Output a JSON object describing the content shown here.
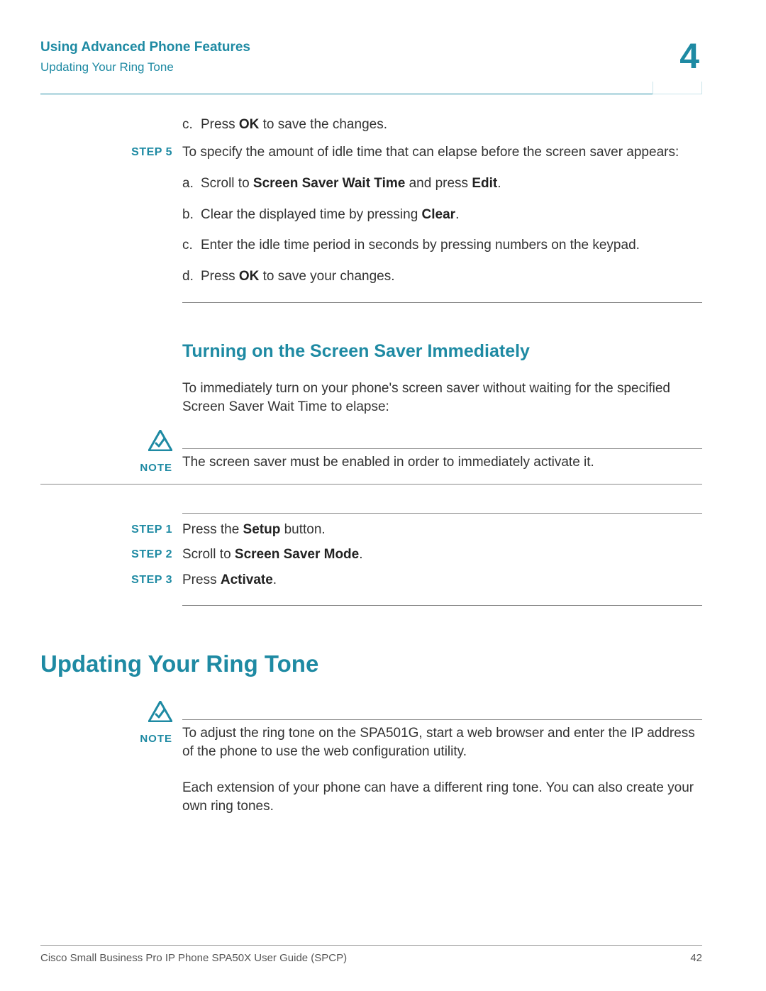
{
  "header": {
    "section": "Using Advanced Phone Features",
    "subsection": "Updating Your Ring Tone",
    "chapter": "4"
  },
  "top_sub": {
    "c_pre": "Press ",
    "c_bold": "OK",
    "c_post": " to save the changes."
  },
  "step5": {
    "label": "STEP 5",
    "intro": "To specify the amount of idle time that can elapse before the screen saver appears:",
    "a_pre": "Scroll to ",
    "a_b1": "Screen Saver Wait Time",
    "a_mid": " and press ",
    "a_b2": "Edit",
    "a_post": ".",
    "b_pre": "Clear the displayed time by pressing ",
    "b_b1": "Clear",
    "b_post": ".",
    "c_text": "Enter the idle time period in seconds by pressing numbers on the keypad.",
    "d_pre": "Press ",
    "d_b1": "OK",
    "d_post": " to save your changes."
  },
  "h2_1": "Turning on the Screen Saver Immediately",
  "para1": "To immediately turn on your phone's screen saver without waiting for the specified Screen Saver Wait Time to elapse:",
  "note1": {
    "label": "NOTE",
    "text": "The screen saver must be enabled in order to immediately activate it."
  },
  "steps2": {
    "s1_label": "STEP 1",
    "s1_pre": "Press the ",
    "s1_b": "Setup",
    "s1_post": " button.",
    "s2_label": "STEP 2",
    "s2_pre": "Scroll to ",
    "s2_b": "Screen Saver Mode",
    "s2_post": ".",
    "s3_label": "STEP 3",
    "s3_pre": "Press ",
    "s3_b": "Activate",
    "s3_post": "."
  },
  "h1": "Updating Your Ring Tone",
  "note2": {
    "label": "NOTE",
    "text": "To adjust the ring tone on the SPA501G, start a web browser and enter the IP address of the phone to use the web configuration utility."
  },
  "para2": "Each extension of your phone can have a different ring tone. You can also create your own ring tones.",
  "footer": {
    "left": "Cisco Small Business Pro IP Phone SPA50X User Guide (SPCP)",
    "right": "42"
  }
}
